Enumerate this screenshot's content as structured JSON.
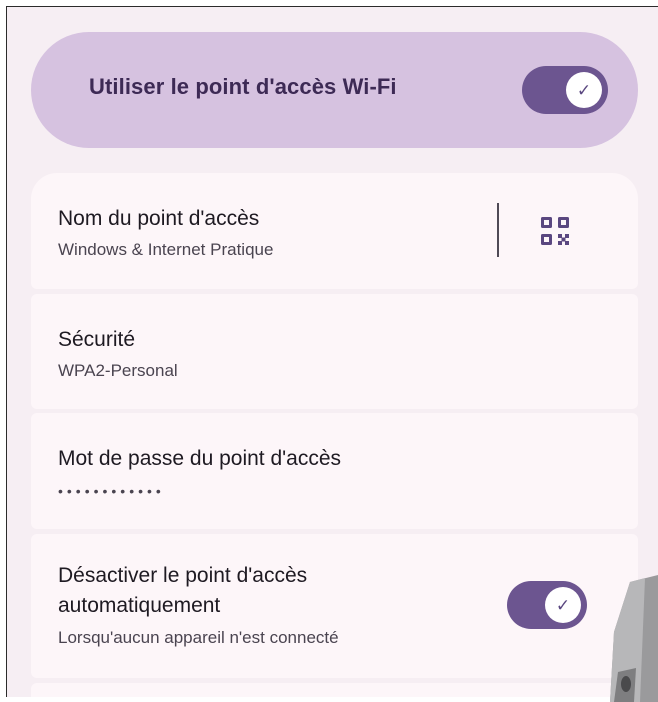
{
  "hotspot": {
    "use_label": "Utiliser le point d'accès Wi-Fi",
    "use_enabled": true
  },
  "settings": {
    "name": {
      "title": "Nom du point d'accès",
      "value": "Windows & Internet Pratique",
      "qr_icon": "qr-code-icon"
    },
    "security": {
      "title": "Sécurité",
      "value": "WPA2-Personal"
    },
    "password": {
      "title": "Mot de passe du point d'accès",
      "masked": "••••••••••••"
    },
    "auto_off": {
      "title_line1": "Désactiver le point d'accès",
      "title_line2": "automatiquement",
      "subtitle": "Lorsqu'aucun appareil n'est connecté",
      "enabled": true
    }
  },
  "icons": {
    "switch_check": "check-icon"
  },
  "colors": {
    "background": "#f6eef3",
    "master_card": "#d6c2e0",
    "card": "#fdf6f9",
    "switch_on": "#6c5590",
    "title_text": "#1e1a22",
    "accent_text": "#3d2a55"
  }
}
